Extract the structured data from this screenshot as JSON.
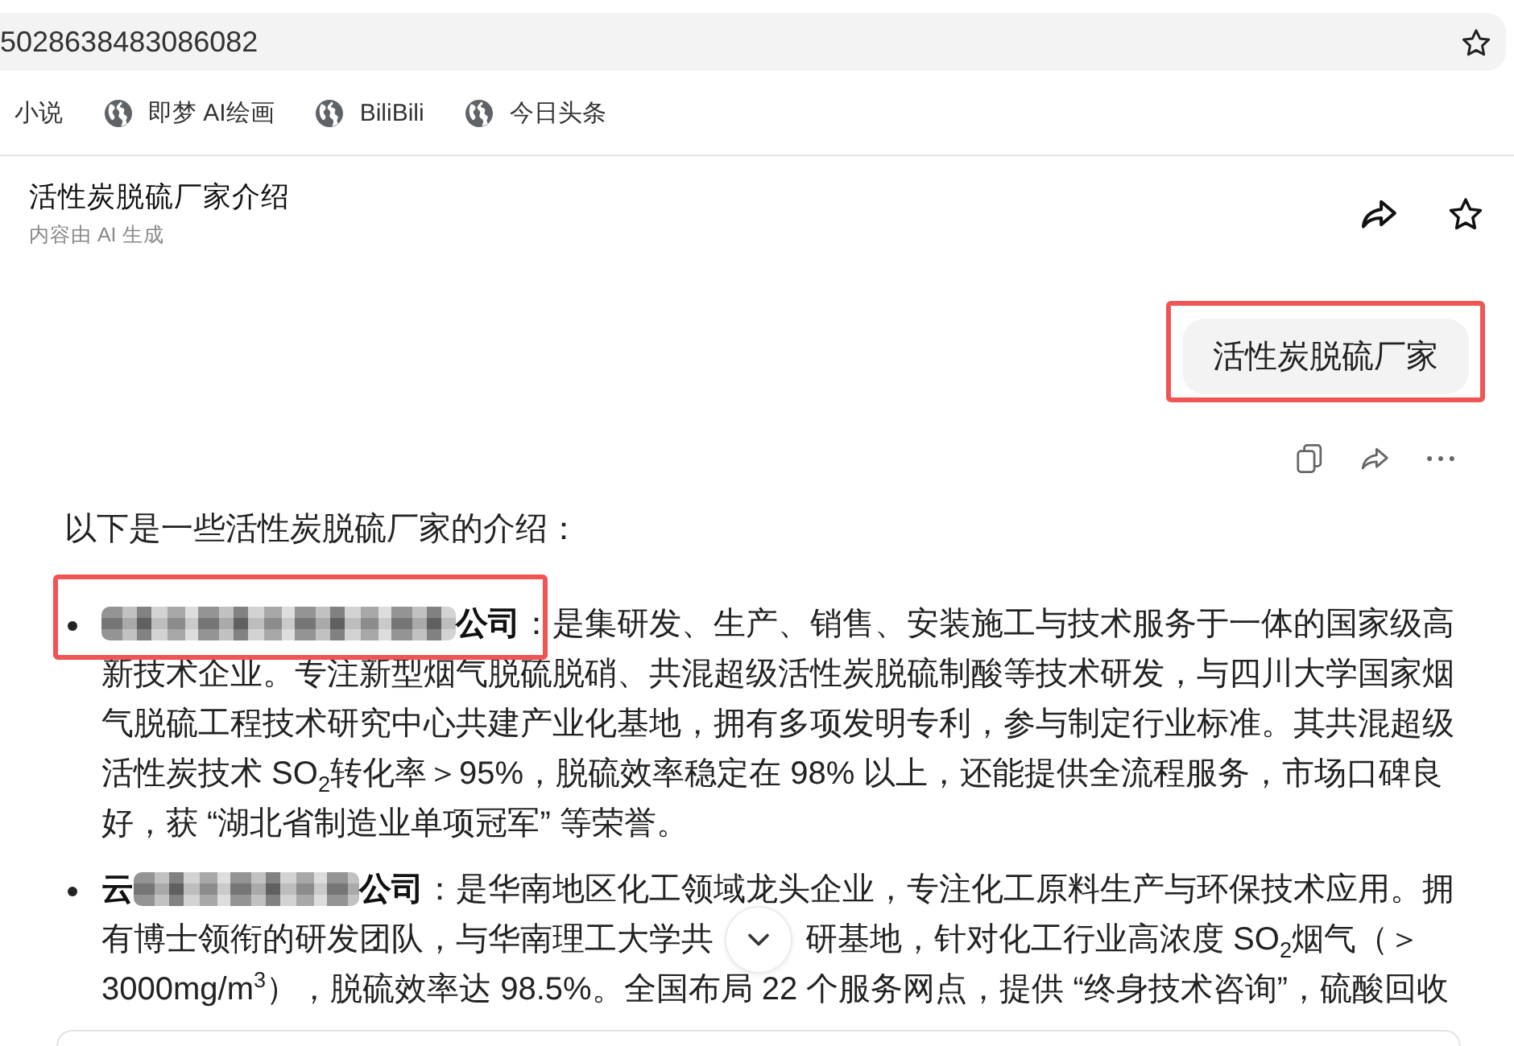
{
  "address_bar": {
    "url": "5028638483086082"
  },
  "bookmarks": [
    {
      "label": "小说",
      "has_icon": false
    },
    {
      "label": "即梦 AI绘画",
      "has_icon": true
    },
    {
      "label": "BiliBili",
      "has_icon": true
    },
    {
      "label": "今日头条",
      "has_icon": true
    }
  ],
  "conversation": {
    "title": "活性炭脱硫厂家介绍",
    "subtitle": "内容由 AI 生成"
  },
  "user_message": {
    "text": "活性炭脱硫厂家",
    "highlighted": true
  },
  "answer": {
    "intro": "以下是一些活性炭脱硫厂家的介绍：",
    "items": [
      {
        "name_end": "公司",
        "highlighted": true,
        "description": "：是集研发、生产、销售、安装施工与技术服务于一体的国家级高新技术企业。专注新型烟气脱硫脱硝、共混超级活性炭脱硫制酸等技术研发，与四川大学国家烟气脱硫工程技术研究中心共建产业化基地，拥有多项发明专利，参与制定行业标准。其共混超级活性炭技术 SO$_{2}$转化率＞95%，脱硫效率稳定在 98% 以上，还能提供全流程服务，市场口碑良好，获 “湖北省制造业单项冠军” 等荣誉。"
      },
      {
        "name_start": "云",
        "name_end": "公司",
        "highlighted": false,
        "description": "：是华南地区化工领域龙头企业，专注化工原料生产与环保技术应用。拥有博士领衔的研发团队，与华南理工大学共",
        "description_continued": "研基地，针对化工行业高浓度 SO$_{2}$烟气（＞3000mg/m$^{3}$），脱硫效率达 98.5%。全国布局 22 个服务网点，提供 “终身技术咨询”，硫酸回收"
      }
    ]
  }
}
